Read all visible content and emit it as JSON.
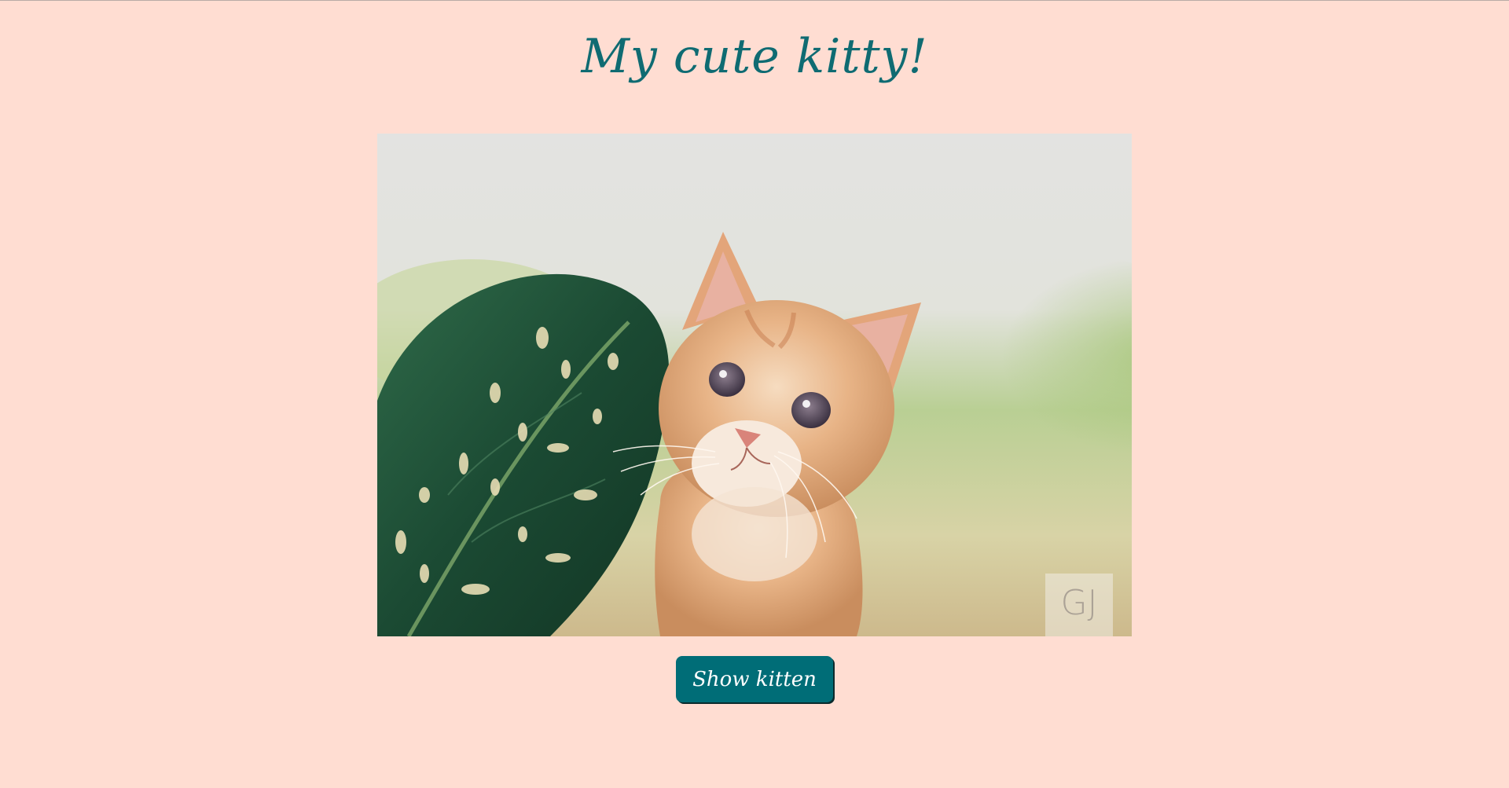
{
  "page": {
    "title": "My cute kitty!"
  },
  "image": {
    "subject": "kitten-photo",
    "watermark": "GJ"
  },
  "button": {
    "label": "Show kitten"
  },
  "colors": {
    "background": "#ffddd2",
    "accent": "#006d77",
    "button_text": "#ffffff"
  }
}
